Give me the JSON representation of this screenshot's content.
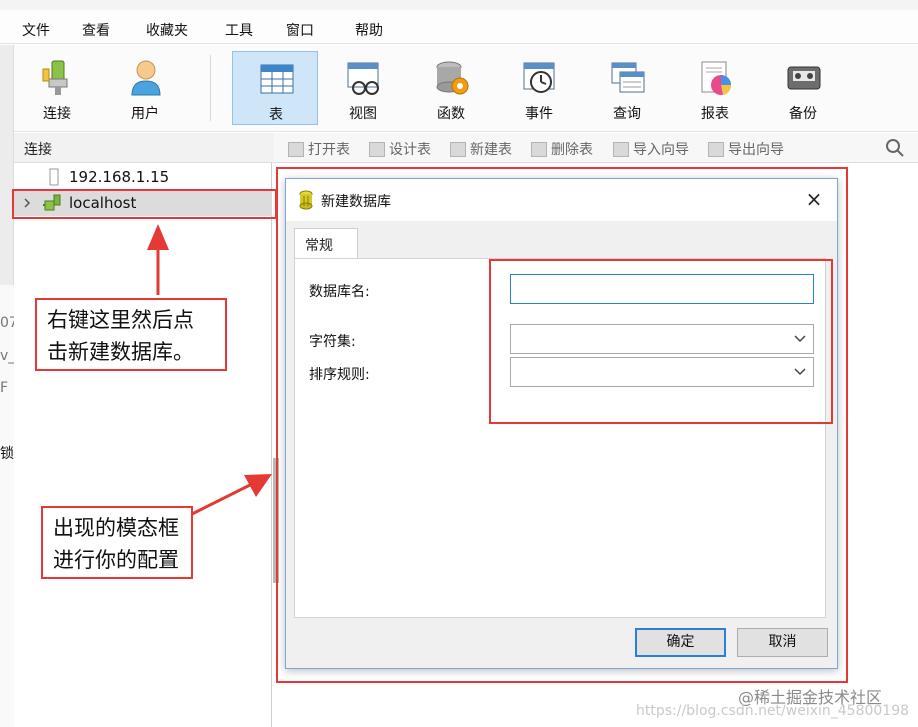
{
  "menu": {
    "items": [
      "文件",
      "查看",
      "收藏夹",
      "工具",
      "窗口",
      "帮助"
    ]
  },
  "toolbar": {
    "items": [
      {
        "label": "连接",
        "icon": "plug-icon"
      },
      {
        "label": "用户",
        "icon": "user-icon"
      },
      {
        "label": "表",
        "icon": "table-icon"
      },
      {
        "label": "视图",
        "icon": "view-icon"
      },
      {
        "label": "函数",
        "icon": "function-icon"
      },
      {
        "label": "事件",
        "icon": "event-clock-icon"
      },
      {
        "label": "查询",
        "icon": "query-icon"
      },
      {
        "label": "报表",
        "icon": "report-icon"
      },
      {
        "label": "备份",
        "icon": "backup-tape-icon"
      }
    ],
    "active": "表"
  },
  "connection_panel": {
    "header": "连接",
    "items": [
      "192.168.1.15",
      "localhost"
    ]
  },
  "sub_toolbar": {
    "items": [
      "打开表",
      "设计表",
      "新建表",
      "删除表",
      "导入向导",
      "导出向导"
    ]
  },
  "dialog": {
    "title": "新建数据库",
    "tab": "常规",
    "fields": {
      "db_name_label": "数据库名:",
      "db_name_value": "",
      "charset_label": "字符集:",
      "charset_value": "",
      "collation_label": "排序规则:",
      "collation_value": ""
    },
    "ok_label": "确定",
    "cancel_label": "取消"
  },
  "annotations": {
    "callout_top_line1": "右键这里然后点",
    "callout_top_line2": "击新建数据库。",
    "callout_bottom_line1": "出现的模态框",
    "callout_bottom_line2": "进行你的配置"
  },
  "left_fragments": [
    "07",
    "v_",
    "F",
    "锁"
  ],
  "watermarks": {
    "juejin": "@稀土掘金技术社区",
    "csdn": "https://blog.csdn.net/weixin_45800198"
  },
  "colors": {
    "accent_red": "#e53935",
    "active_tool_bg": "#cfe5f8",
    "focus_blue": "#2d82c7"
  }
}
